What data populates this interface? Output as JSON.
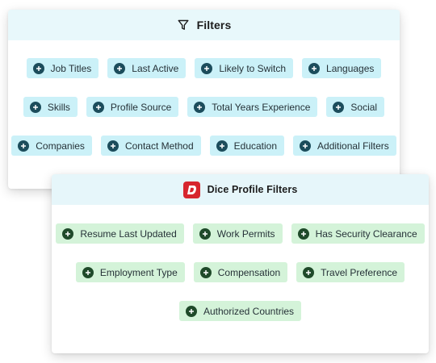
{
  "filters_card": {
    "title": "Filters",
    "icon": "filter-icon",
    "rows": [
      [
        "Job Titles",
        "Last Active",
        "Likely to Switch",
        "Languages"
      ],
      [
        "Skills",
        "Profile Source",
        "Total Years Experience",
        "Social"
      ],
      [
        "Companies",
        "Contact Method",
        "Education",
        "Additional Filters"
      ]
    ]
  },
  "dice_card": {
    "title": "Dice Profile Filters",
    "logo_letter": "D",
    "rows": [
      [
        "Resume Last Updated",
        "Work Permits",
        "Has Security Clearance"
      ],
      [
        "Employment Type",
        "Compensation",
        "Travel Preference"
      ],
      [
        "Authorized Countries"
      ]
    ]
  },
  "colors": {
    "filters_header_bg": "#e8f8fb",
    "filters_chip_bg": "#cbf1f8",
    "dice_chip_bg": "#d4f3d9",
    "dice_logo": "#d7262e"
  }
}
